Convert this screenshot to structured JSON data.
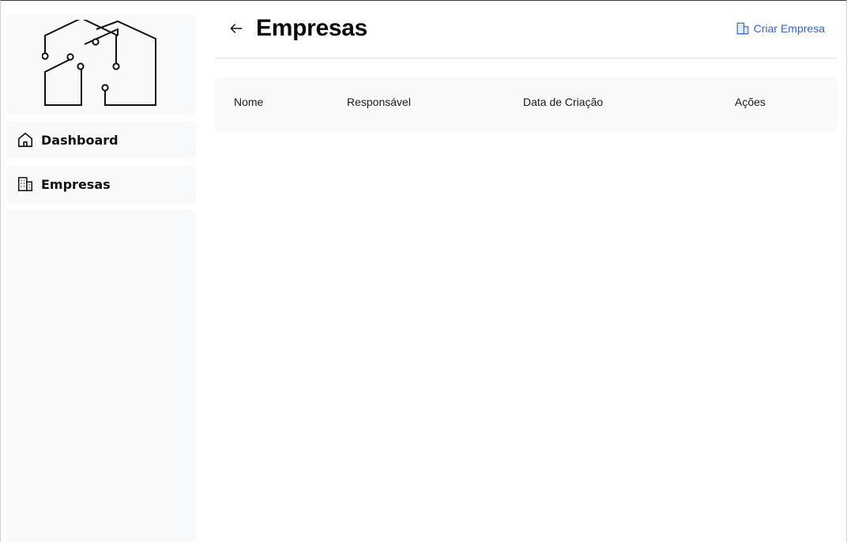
{
  "sidebar": {
    "logo_name": "circuit-house-logo",
    "items": [
      {
        "label": "Dashboard",
        "icon": "home-icon"
      },
      {
        "label": "Empresas",
        "icon": "building-icon"
      }
    ]
  },
  "header": {
    "title": "Empresas",
    "back_icon": "arrow-left-icon",
    "create_button": {
      "label": "Criar Empresa",
      "icon": "building-icon"
    }
  },
  "table": {
    "columns": [
      "Nome",
      "Responsável",
      "Data de Criação",
      "Ações"
    ],
    "rows": []
  },
  "colors": {
    "accent": "#2f64d8",
    "card_bg": "#f8f9fa",
    "divider": "#e5e7eb"
  }
}
